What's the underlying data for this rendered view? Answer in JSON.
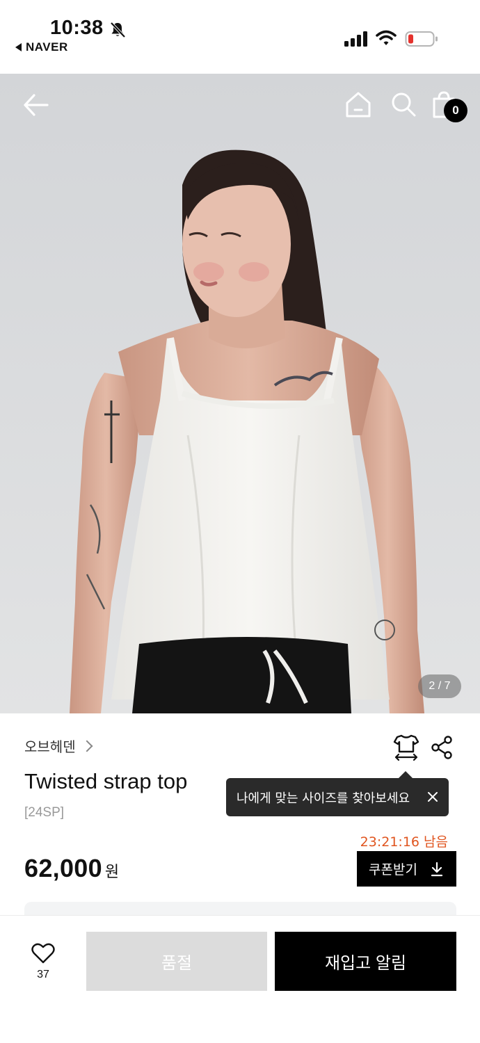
{
  "status_bar": {
    "time": "10:38",
    "back_app": "NAVER",
    "icons": [
      "bell-mute-icon",
      "cellular-signal-icon",
      "wifi-icon",
      "battery-low-icon"
    ]
  },
  "header": {
    "icons": [
      "back-arrow-icon",
      "home-icon",
      "search-icon",
      "shopping-bag-icon"
    ],
    "cart_count": "0"
  },
  "gallery": {
    "counter": "2 / 7"
  },
  "product": {
    "brand": "오브헤덴",
    "title": "Twisted strap top",
    "season": "[24SP]",
    "price": "62,000",
    "currency": "원",
    "size_tooltip": "나에게 맞는 사이즈를 찾아보세요",
    "coupon_timer": "23:21:16 남음",
    "coupon_button": "쿠폰받기"
  },
  "bottom_bar": {
    "like_count": "37",
    "soldout_label": "품절",
    "restock_label": "재입고 알림"
  },
  "colors": {
    "timer": "#e0551f",
    "primary_button": "#000000",
    "disabled_button": "#dcdcdc",
    "tooltip_bg": "#2a2a2a"
  }
}
